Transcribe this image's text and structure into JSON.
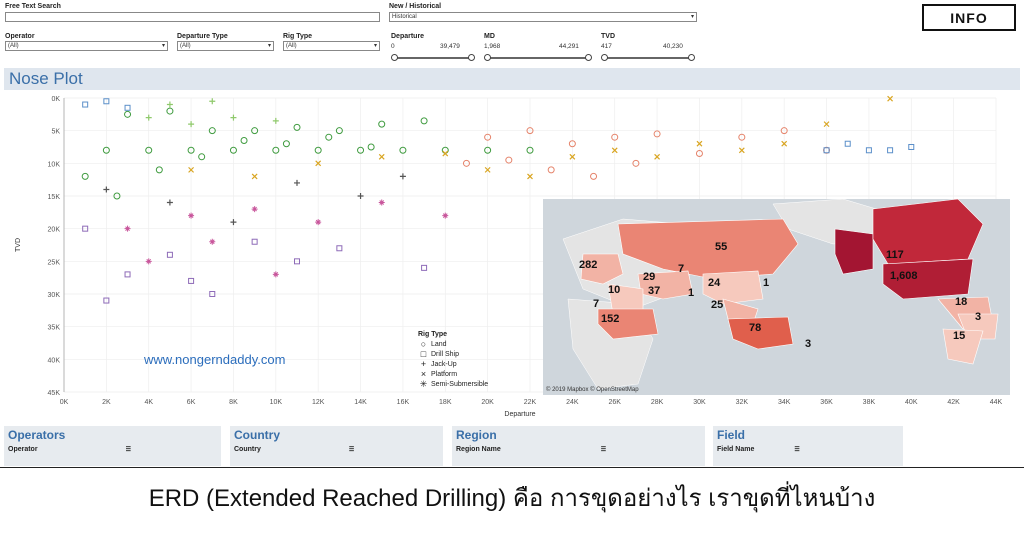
{
  "filters": {
    "free_text": {
      "label": "Free Text Search",
      "value": ""
    },
    "new_historical": {
      "label": "New / Historical",
      "value": "Historical"
    },
    "operator": {
      "label": "Operator",
      "value": "(All)"
    },
    "departure_type": {
      "label": "Departure Type",
      "value": "(All)"
    },
    "rig_type": {
      "label": "Rig Type",
      "value": "(All)"
    }
  },
  "ranges": [
    {
      "label": "Departure",
      "min": "0",
      "max": "39,479"
    },
    {
      "label": "MD",
      "min": "1,968",
      "max": "44,291"
    },
    {
      "label": "TVD",
      "min": "417",
      "max": "40,230"
    }
  ],
  "info_button": "INFO",
  "title": "Nose Plot",
  "chart_data": {
    "type": "scatter",
    "title": "Nose Plot",
    "xlabel": "Departure",
    "ylabel": "TVD",
    "xlim": [
      0,
      44000
    ],
    "ylim": [
      0,
      45000
    ],
    "y_inverted": true,
    "x_ticks": [
      "0K",
      "2K",
      "4K",
      "6K",
      "8K",
      "10K",
      "12K",
      "14K",
      "16K",
      "18K",
      "20K",
      "22K",
      "24K",
      "26K",
      "28K",
      "30K",
      "32K",
      "34K",
      "36K",
      "38K",
      "40K",
      "42K",
      "44K"
    ],
    "y_ticks": [
      "0K",
      "5K",
      "10K",
      "15K",
      "20K",
      "25K",
      "30K",
      "35K",
      "40K",
      "45K"
    ],
    "grid": true,
    "series": [
      {
        "name": "Land",
        "color": "#3f9b3f",
        "values": [
          [
            2000,
            8000
          ],
          [
            4000,
            8000
          ],
          [
            6000,
            8000
          ],
          [
            8000,
            8000
          ],
          [
            10000,
            8000
          ],
          [
            12000,
            8000
          ],
          [
            14000,
            8000
          ],
          [
            16000,
            8000
          ],
          [
            18000,
            8000
          ],
          [
            20000,
            8000
          ],
          [
            22000,
            8000
          ],
          [
            3000,
            2500
          ],
          [
            5000,
            2000
          ],
          [
            7000,
            5000
          ],
          [
            9000,
            5000
          ],
          [
            11000,
            4500
          ],
          [
            13000,
            5000
          ],
          [
            15000,
            4000
          ],
          [
            17000,
            3500
          ],
          [
            1000,
            12000
          ],
          [
            2500,
            15000
          ],
          [
            4500,
            11000
          ],
          [
            6500,
            9000
          ],
          [
            8500,
            6500
          ],
          [
            10500,
            7000
          ],
          [
            12500,
            6000
          ],
          [
            14500,
            7500
          ]
        ]
      },
      {
        "name": "Drill Ship",
        "color": "#8e6bb8",
        "values": [
          [
            1000,
            20000
          ],
          [
            3000,
            27000
          ],
          [
            5000,
            24000
          ],
          [
            7000,
            30000
          ],
          [
            9000,
            22000
          ],
          [
            11000,
            25000
          ],
          [
            13000,
            23000
          ],
          [
            17000,
            26000
          ],
          [
            2000,
            31000
          ],
          [
            6000,
            28000
          ]
        ]
      },
      {
        "name": "Jack-Up",
        "color": "#555555",
        "values": [
          [
            2000,
            14000
          ],
          [
            5000,
            16000
          ],
          [
            8000,
            19000
          ],
          [
            11000,
            13000
          ],
          [
            14000,
            15000
          ],
          [
            16000,
            12000
          ]
        ]
      },
      {
        "name": "Platform",
        "color": "#d9a521",
        "values": [
          [
            6000,
            11000
          ],
          [
            9000,
            12000
          ],
          [
            12000,
            10000
          ],
          [
            15000,
            9000
          ],
          [
            18000,
            8500
          ],
          [
            20000,
            11000
          ],
          [
            22000,
            12000
          ],
          [
            24000,
            9000
          ],
          [
            26000,
            8000
          ],
          [
            28000,
            9000
          ],
          [
            30000,
            7000
          ],
          [
            32000,
            8000
          ],
          [
            34000,
            7000
          ],
          [
            36000,
            4000
          ],
          [
            39000,
            100
          ]
        ]
      },
      {
        "name": "Semi-Submersible",
        "color": "#c8559b",
        "values": [
          [
            3000,
            20000
          ],
          [
            6000,
            18000
          ],
          [
            9000,
            17000
          ],
          [
            12000,
            19000
          ],
          [
            15000,
            16000
          ],
          [
            18000,
            18000
          ],
          [
            4000,
            25000
          ],
          [
            7000,
            22000
          ],
          [
            10000,
            27000
          ]
        ]
      },
      {
        "name": "",
        "color": "#e5836a",
        "values": [
          [
            20000,
            6000
          ],
          [
            22000,
            5000
          ],
          [
            24000,
            7000
          ],
          [
            26000,
            6000
          ],
          [
            28000,
            5500
          ],
          [
            30000,
            8500
          ],
          [
            32000,
            6000
          ],
          [
            34000,
            5000
          ],
          [
            36000,
            8000
          ],
          [
            19000,
            10000
          ],
          [
            21000,
            9500
          ],
          [
            23000,
            11000
          ],
          [
            25000,
            12000
          ],
          [
            27000,
            10000
          ]
        ]
      },
      {
        "name": "",
        "color": "#5b8fc9",
        "values": [
          [
            1000,
            1000
          ],
          [
            2000,
            500
          ],
          [
            3000,
            1500
          ],
          [
            36000,
            8000
          ],
          [
            37000,
            7000
          ],
          [
            38000,
            8000
          ],
          [
            39000,
            8000
          ],
          [
            40000,
            7500
          ]
        ]
      },
      {
        "name": "",
        "color": "#8fc96b",
        "values": [
          [
            4000,
            3000
          ],
          [
            6000,
            4000
          ],
          [
            8000,
            3000
          ],
          [
            10000,
            3500
          ],
          [
            5000,
            1000
          ],
          [
            7000,
            500
          ]
        ]
      }
    ]
  },
  "legend": {
    "title": "Rig Type",
    "items": [
      {
        "label": "Land",
        "symbol": "○",
        "icon": "circle-icon"
      },
      {
        "label": "Drill Ship",
        "symbol": "□",
        "icon": "square-icon"
      },
      {
        "label": "Jack-Up",
        "symbol": "+",
        "icon": "plus-icon"
      },
      {
        "label": "Platform",
        "symbol": "×",
        "icon": "x-icon"
      },
      {
        "label": "Semi-Submersible",
        "symbol": "✳",
        "icon": "asterisk-icon"
      }
    ]
  },
  "map": {
    "attribution": "© 2019 Mapbox © OpenStreetMap",
    "labels": [
      "55",
      "282",
      "29",
      "7",
      "10",
      "37",
      "1",
      "24",
      "1",
      "7",
      "25",
      "152",
      "78",
      "3",
      "117",
      "1,608",
      "18",
      "3",
      "15",
      "3"
    ],
    "colors": {
      "low": "#f6c9bd",
      "mid": "#e8796a",
      "high": "#c1283a",
      "max": "#a31532"
    }
  },
  "watermark": "www.nongerndaddy.com",
  "panels": [
    {
      "title": "Operators",
      "column": "Operator"
    },
    {
      "title": "Country",
      "column": "Country"
    },
    {
      "title": "Region",
      "column": "Region Name"
    },
    {
      "title": "Field",
      "column": "Field Name"
    }
  ],
  "caption": "ERD (Extended Reached Drilling) คือ การขุดอย่างไร เราขุดที่ไหนบ้าง"
}
